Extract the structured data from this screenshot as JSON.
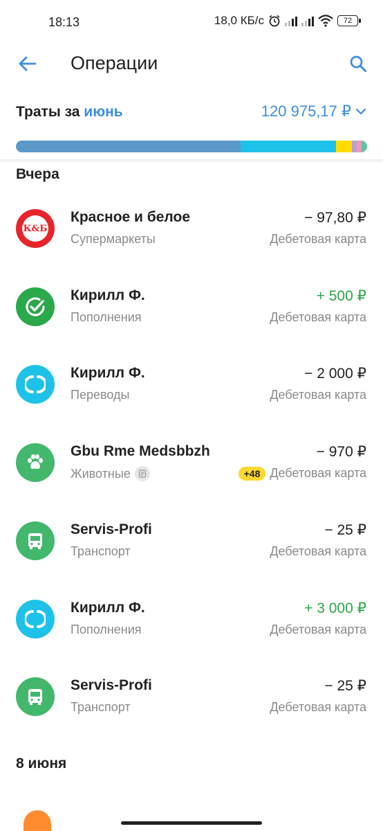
{
  "status": {
    "time": "18:13",
    "speed": "18,0 КБ/с",
    "battery": "72"
  },
  "header": {
    "title": "Операции"
  },
  "spending": {
    "label_prefix": "Траты за",
    "month": "июнь",
    "amount": "120 975,17 ₽",
    "segments": [
      {
        "color": "#5b99c9",
        "share": 0.64
      },
      {
        "color": "#1ec2e8",
        "share": 0.272
      },
      {
        "color": "#ffdd00",
        "share": 0.045
      },
      {
        "color": "#b9a0d6",
        "share": 0.014
      },
      {
        "color": "#f29ab5",
        "share": 0.013
      },
      {
        "color": "#5cc3a3",
        "share": 0.016
      }
    ]
  },
  "sections": [
    {
      "title": "Вчера",
      "transactions": [
        {
          "name": "Красное и белое",
          "category": "Супермаркеты",
          "amount": "− 97,80 ₽",
          "positive": false,
          "account": "Дебетовая карта",
          "icon": "kb-logo-icon",
          "icon_bg": "#e8242b",
          "logo_text": "К&Б"
        },
        {
          "name": "Кирилл Ф.",
          "category": "Пополнения",
          "amount": "+ 500 ₽",
          "positive": true,
          "account": "Дебетовая карта",
          "icon": "check-circle-icon",
          "icon_bg": "#2aa84a"
        },
        {
          "name": "Кирилл Ф.",
          "category": "Переводы",
          "amount": "− 2 000 ₽",
          "positive": false,
          "account": "Дебетовая карта",
          "icon": "transfer-icon",
          "icon_bg": "#1ec2e8"
        },
        {
          "name": "Gbu Rme Medsbbzh",
          "category": "Животные",
          "amount": "− 970 ₽",
          "positive": false,
          "account": "Дебетовая карта",
          "icon": "paw-icon",
          "icon_bg": "#43b86c",
          "has_note": true,
          "bonus": "+48"
        },
        {
          "name": "Servis-Profi",
          "category": "Транспорт",
          "amount": "− 25 ₽",
          "positive": false,
          "account": "Дебетовая карта",
          "icon": "bus-icon",
          "icon_bg": "#43b86c"
        },
        {
          "name": "Кирилл Ф.",
          "category": "Пополнения",
          "amount": "+ 3 000 ₽",
          "positive": true,
          "account": "Дебетовая карта",
          "icon": "transfer-icon",
          "icon_bg": "#1ec2e8"
        },
        {
          "name": "Servis-Profi",
          "category": "Транспорт",
          "amount": "− 25 ₽",
          "positive": false,
          "account": "Дебетовая карта",
          "icon": "bus-icon",
          "icon_bg": "#43b86c"
        }
      ]
    },
    {
      "title": "8 июня",
      "transactions": []
    }
  ]
}
